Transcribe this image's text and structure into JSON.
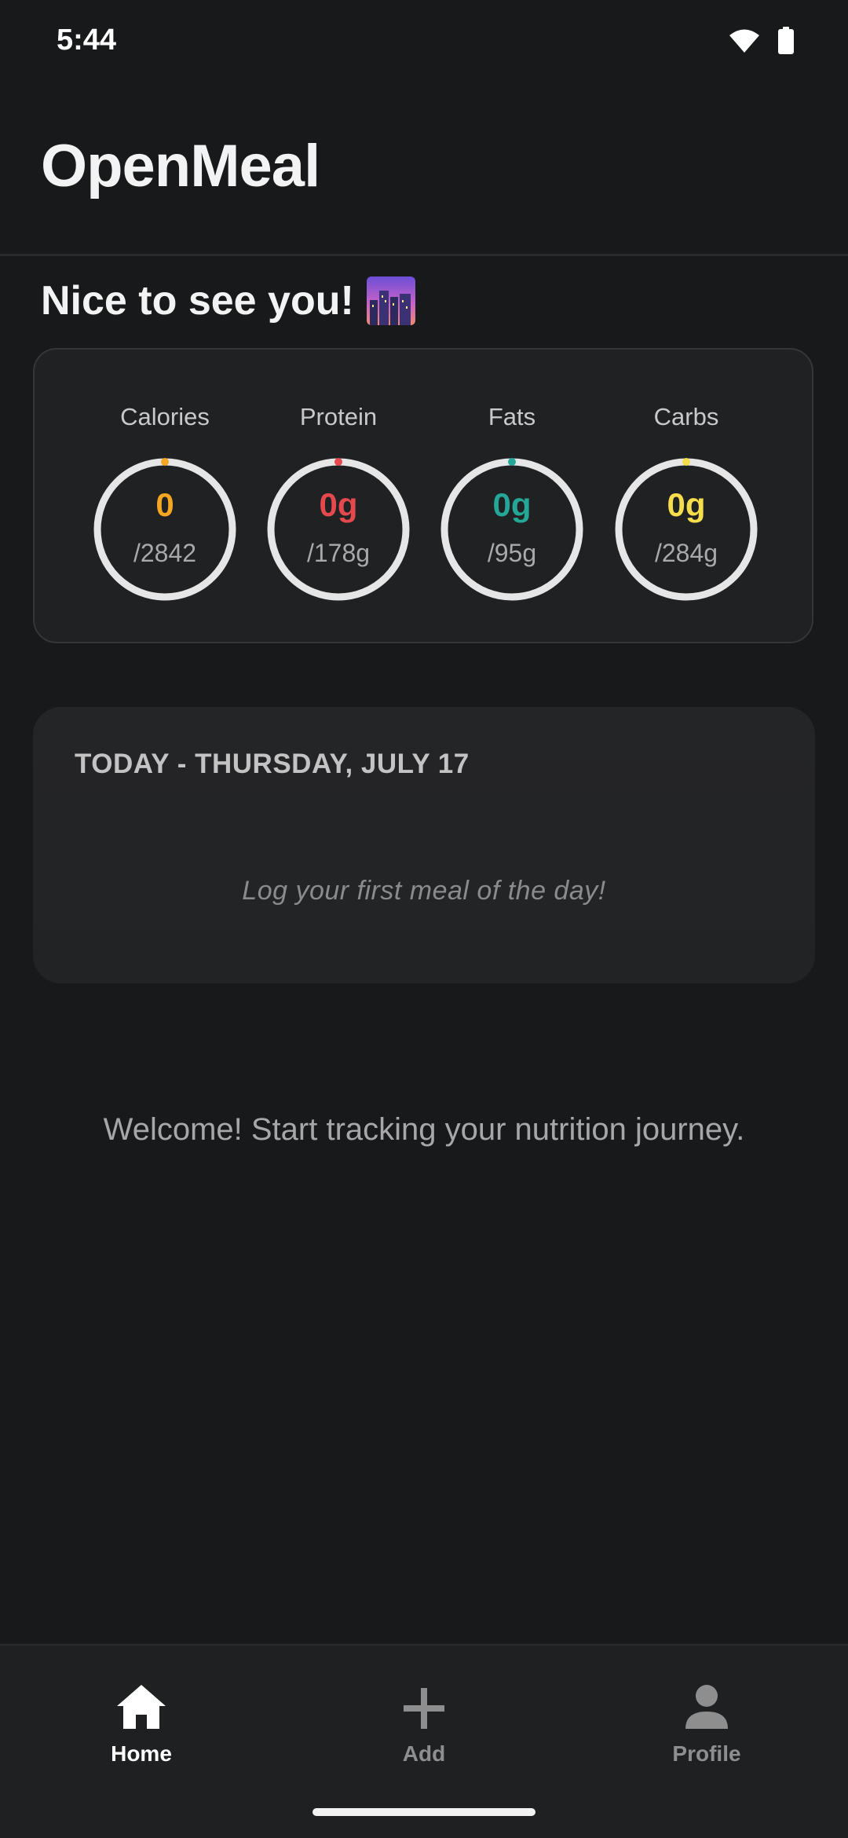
{
  "status_bar": {
    "time": "5:44",
    "icons": [
      "wifi-icon",
      "battery-icon"
    ]
  },
  "header": {
    "title": "OpenMeal"
  },
  "greeting": {
    "text": "Nice to see you!",
    "emoji": "night-cityscape-emoji"
  },
  "macros": [
    {
      "label": "Calories",
      "value": "0",
      "target": "/2842",
      "color": "#f5a623",
      "progress": 0
    },
    {
      "label": "Protein",
      "value": "0g",
      "target": "/178g",
      "color": "#e5484d",
      "progress": 0
    },
    {
      "label": "Fats",
      "value": "0g",
      "target": "/95g",
      "color": "#25a797",
      "progress": 0
    },
    {
      "label": "Carbs",
      "value": "0g",
      "target": "/284g",
      "color": "#f5dd4b",
      "progress": 0
    }
  ],
  "today": {
    "title": "TODAY - THURSDAY, JULY 17",
    "empty_message": "Log your first meal of the day!"
  },
  "welcome": "Welcome! Start tracking your nutrition journey.",
  "nav": {
    "items": [
      {
        "label": "Home",
        "icon": "home-icon",
        "active": true
      },
      {
        "label": "Add",
        "icon": "plus-icon",
        "active": false
      },
      {
        "label": "Profile",
        "icon": "person-icon",
        "active": false
      }
    ],
    "active_color": "#ffffff",
    "inactive_color": "#8e8e8e"
  }
}
